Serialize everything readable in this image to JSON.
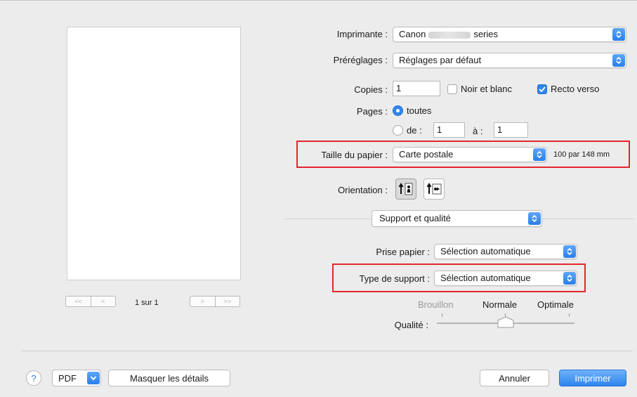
{
  "printer": {
    "label": "Imprimante :",
    "value_prefix": "Canon",
    "value_suffix": "series"
  },
  "presets": {
    "label": "Préréglages :",
    "value": "Réglages par défaut"
  },
  "copies": {
    "label": "Copies :",
    "value": "1",
    "bw_label": "Noir et blanc",
    "bw_checked": false,
    "duplex_label": "Recto verso",
    "duplex_checked": true
  },
  "pages": {
    "label": "Pages :",
    "all_label": "toutes",
    "from_label": "de :",
    "from_value": "1",
    "to_label": "à :",
    "to_value": "1",
    "selected": "all"
  },
  "paper_size": {
    "label": "Taille du papier :",
    "value": "Carte postale",
    "dimensions": "100 par 148 mm"
  },
  "orientation": {
    "label": "Orientation :",
    "options": [
      "portrait-icon",
      "landscape-icon"
    ],
    "selected": "portrait"
  },
  "section": {
    "value": "Support et qualité"
  },
  "paper_source": {
    "label": "Prise papier :",
    "value": "Sélection automatique"
  },
  "media_type": {
    "label": "Type de support :",
    "value": "Sélection automatique"
  },
  "quality": {
    "label": "Qualité :",
    "levels": [
      "Brouillon",
      "Normale",
      "Optimale"
    ],
    "selected": "Normale",
    "selected_index": 1
  },
  "preview": {
    "page_indicator": "1 sur 1",
    "first": "<<",
    "prev": "<",
    "next": ">",
    "last": ">>"
  },
  "footer": {
    "help": "?",
    "pdf": "PDF",
    "hide_details": "Masquer les détails",
    "cancel": "Annuler",
    "print": "Imprimer"
  },
  "colors": {
    "accent": "#2f86ee",
    "highlight": "#e5262c"
  }
}
